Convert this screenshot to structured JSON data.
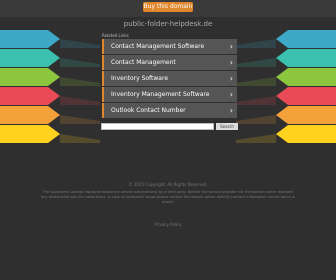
{
  "topbar": {
    "buy_label": "Buy this domain"
  },
  "domain": "public-folder-helpdesk.de",
  "related_label": "Related Links",
  "links": [
    "Contact Management Software",
    "Contact Management",
    "Inventory Software",
    "Inventory Management Software",
    "Outlook Contact Number"
  ],
  "search": {
    "button_label": "Search Ads"
  },
  "footer": {
    "copyright": "© 2025 Copyright. All Rights Reserved.",
    "disclaimer": "The Sponsored Listings displayed above are served automatically by a third party. Neither the service provider nor the domain owner maintain any relationship with the advertisers. In case of trademark issues please contact the domain owner directly (contact information can be found in whois).",
    "privacy": "Privacy Policy"
  },
  "colors": {
    "accent": "#e0862c",
    "ribbons": [
      "#3ea8c9",
      "#3bbfae",
      "#8cc63f",
      "#e84b55",
      "#f3a23a",
      "#ffd21f"
    ]
  }
}
